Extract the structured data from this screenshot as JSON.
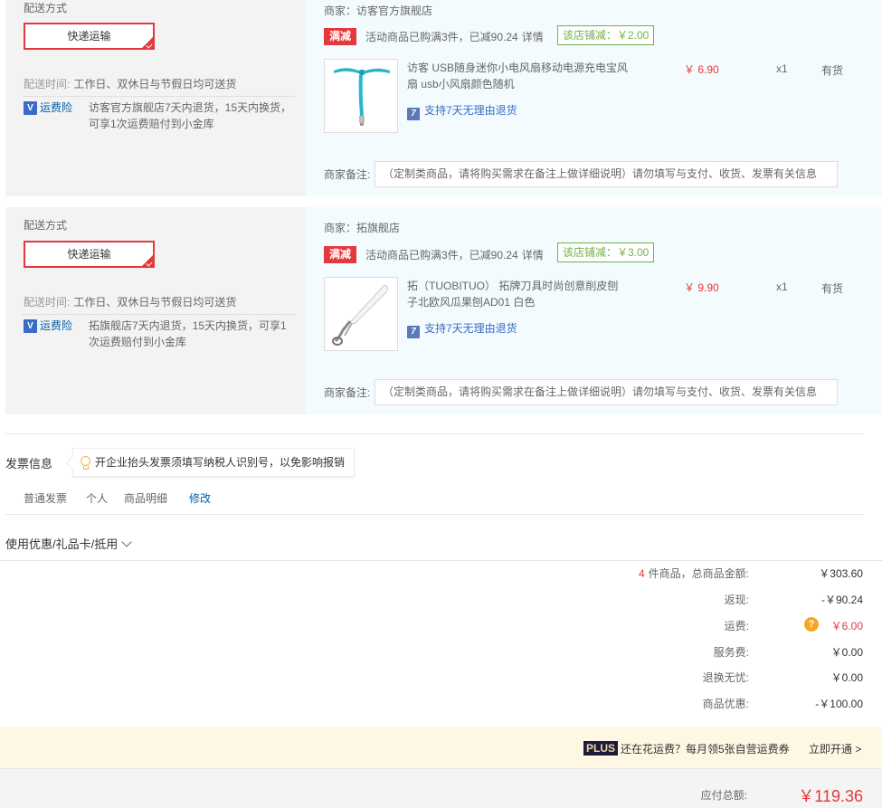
{
  "shipment_blocks": [
    {
      "shipping_label": "配送方式",
      "shipping_method": "快递运输",
      "delivery_time_label": "配送时间:",
      "delivery_time_value": "工作日、双休日与节假日均可送货",
      "insurance_name": "运费险",
      "insurance_desc": "访客官方旗舰店7天内退货，15天内换货，可享1次运费赔付到小金库",
      "seller": "商家：访客官方旗舰店",
      "promo_tag": "满减",
      "promo_text": "活动商品已购满3件，已减90.24",
      "promo_link": "详情",
      "store_discount": "该店铺减：￥2.00",
      "product_name": "访客 USB随身迷你小电风扇移动电源充电宝风扇 usb小风扇颜色随机",
      "return_policy": "支持7天无理由退货",
      "price": "￥ 6.90",
      "quantity": "x1",
      "stock": "有货",
      "remark_label": "商家备注:",
      "remark_placeholder": "（定制类商品，请将购买需求在备注上做详细说明）请勿填写与支付、收货、发票有关信息",
      "thumb_icon": "usb-fan-image"
    },
    {
      "shipping_label": "配送方式",
      "shipping_method": "快递运输",
      "delivery_time_label": "配送时间:",
      "delivery_time_value": "工作日、双休日与节假日均可送货",
      "insurance_name": "运费险",
      "insurance_desc": "拓旗舰店7天内退货，15天内换货，可享1次运费赔付到小金库",
      "seller": "商家：拓旗舰店",
      "promo_tag": "满减",
      "promo_text": "活动商品已购满3件，已减90.24",
      "promo_link": "详情",
      "store_discount": "该店铺减：￥3.00",
      "product_name": "拓（TUOBITUO） 拓牌刀具时尚创意削皮刨子北欧风瓜果刨AD01 白色",
      "return_policy": "支持7天无理由退货",
      "price": "￥ 9.90",
      "quantity": "x1",
      "stock": "有货",
      "remark_label": "商家备注:",
      "remark_placeholder": "（定制类商品，请将购买需求在备注上做详细说明）请勿填写与支付、收货、发票有关信息",
      "thumb_icon": "peeler-image"
    }
  ],
  "invoice": {
    "title": "发票信息",
    "tip": "开企业抬头发票须填写纳税人识别号，以免影响报销",
    "type": "普通发票",
    "header": "个人",
    "content": "商品明细",
    "edit": "修改"
  },
  "coupon": {
    "label": "使用优惠/礼品卡/抵用"
  },
  "summary": {
    "count": "4",
    "count_label": "件商品，总商品金额:",
    "total_goods": "￥303.60",
    "rebate_label": "返现:",
    "rebate": "-￥90.24",
    "freight_label": "运费:",
    "freight": "￥6.00",
    "service_label": "服务费:",
    "service": "￥0.00",
    "worry_free_label": "退换无忧:",
    "worry_free": "￥0.00",
    "discount_label": "商品优惠:",
    "discount": "-￥100.00"
  },
  "plus": {
    "tag": "PLUS",
    "text": "还在花运费？每月领5张自营运费券",
    "open": "立即开通 >"
  },
  "payment": {
    "label": "应付总额:",
    "total": "￥119.36"
  },
  "colors": {
    "accent_red": "#e4393c",
    "link_blue": "#005ea7",
    "green": "#71b247"
  }
}
